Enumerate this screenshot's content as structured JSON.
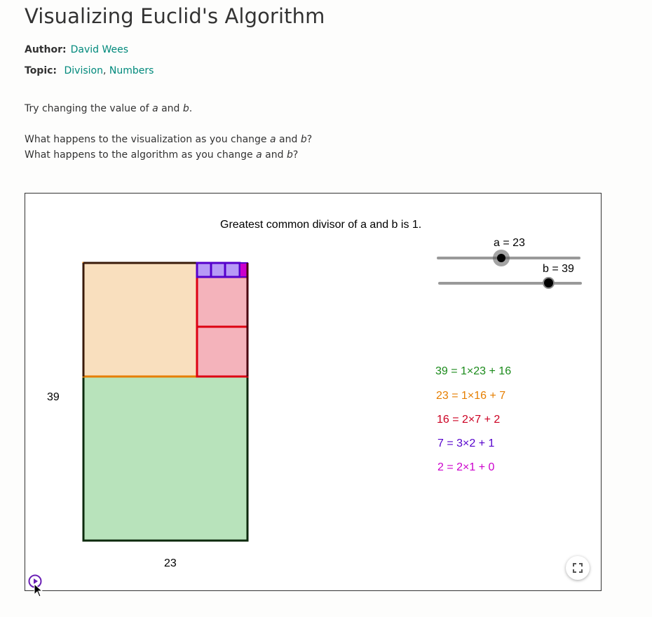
{
  "page": {
    "title": "Visualizing Euclid's Algorithm",
    "author_label": "Author:",
    "author_name": "David Wees",
    "topic_label": "Topic:",
    "topic_1": "Division",
    "topic_sep": ",",
    "topic_2": "Numbers",
    "line1_a": "Try changing the value of ",
    "line1_var_a": "a",
    "line1_mid": " and ",
    "line1_var_b": "b",
    "line1_end": ".",
    "line2_a": "What happens to the visualization as you change ",
    "line2_var_a": "a",
    "line2_mid": " and ",
    "line2_var_b": "b",
    "line2_end": "?",
    "line3_a": "What happens to the algorithm as you change ",
    "line3_var_a": "a",
    "line3_mid": " and ",
    "line3_var_b": "b",
    "line3_end": "?"
  },
  "applet": {
    "gcd_text": "Greatest common divisor of a and b is 1.",
    "slider_a_label": "a = 23",
    "slider_b_label": "b = 39",
    "slider_a_value": 23,
    "slider_b_value": 39,
    "height_label": "39",
    "width_label": "23",
    "equations": [
      {
        "text": "39 = 1×23 + 16",
        "color": "#1a8a1a"
      },
      {
        "text": "23 = 1×16 + 7",
        "color": "#e67e00"
      },
      {
        "text": "16 = 2×7 + 2",
        "color": "#cc0022"
      },
      {
        "text": "7 = 3×2 + 1",
        "color": "#5500cc"
      },
      {
        "text": "2 = 2×1 + 0",
        "color": "#cc00cc"
      }
    ],
    "icons": {
      "fullscreen": "fullscreen-icon",
      "play": "play-icon",
      "cursor": "mouse-cursor-icon"
    },
    "colors": {
      "green_fill": "#b8e3bb",
      "green_border": "#0d2a0d",
      "orange_fill": "#f9dfbe",
      "orange_border": "#e67e00",
      "red_fill": "#f4b3bb",
      "red_border": "#dd0011",
      "purple_fill": "#b79af6",
      "purple_border": "#5500cc",
      "magenta": "#cc00cc"
    }
  }
}
